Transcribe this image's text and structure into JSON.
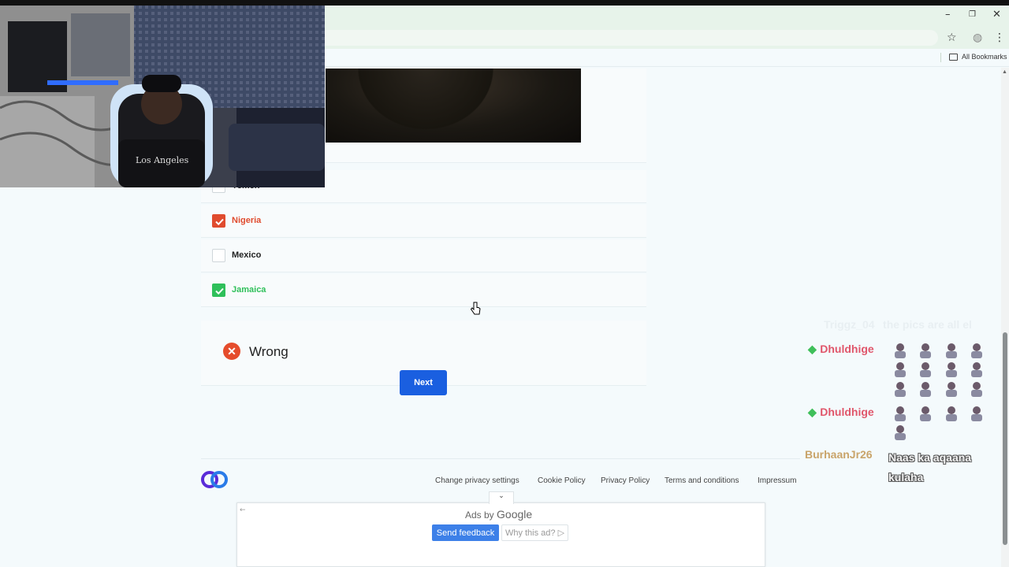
{
  "browser": {
    "bookmarks_label": "All Bookmarks",
    "window_controls": {
      "minimize": "–",
      "restore": "❐",
      "close": "✕"
    },
    "icons": [
      "star-icon",
      "extension-icon",
      "menu-icon",
      "folder-icon"
    ]
  },
  "quiz": {
    "options": [
      {
        "label": "Yemen",
        "state": "unchecked"
      },
      {
        "label": "Nigeria",
        "state": "wrong-selected"
      },
      {
        "label": "Mexico",
        "state": "unchecked"
      },
      {
        "label": "Jamaica",
        "state": "correct"
      }
    ],
    "result": "Wrong",
    "next_label": "Next"
  },
  "footer": {
    "links": [
      "Change privacy settings",
      "Cookie Policy",
      "Privacy Policy",
      "Terms and conditions",
      "Impressum"
    ]
  },
  "ad": {
    "ads_by_prefix": "Ads by",
    "ads_by_brand": "Google",
    "feedback_label": "Send feedback",
    "why_label": "Why this ad?"
  },
  "chat": {
    "messages": [
      {
        "user": "Triggz_04",
        "text": "the pics are all el"
      },
      {
        "user": "Dhuldhige",
        "text": ""
      },
      {
        "user": "Dhuldhige",
        "text": ""
      },
      {
        "user": "BurhaanJr26",
        "text": "Naas ka aqaana kulaha"
      }
    ]
  },
  "colors": {
    "wrong": "#e04b2e",
    "correct": "#2fc05a",
    "primary": "#1a5fe0",
    "user_dhuldhige": "#e0566b",
    "user_burhaan": "#c9a46a"
  }
}
